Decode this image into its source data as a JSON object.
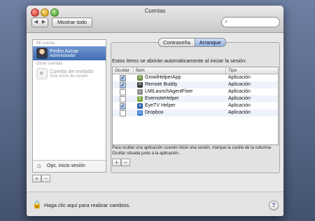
{
  "window": {
    "title": "Cuentas"
  },
  "toolbar": {
    "back_icon": "◀",
    "forward_icon": "▶",
    "show_all_label": "Mostrar todo",
    "search_icon": "⌕",
    "search_placeholder": ""
  },
  "sidebar": {
    "my_account_header": "Mi cuenta",
    "current_user": {
      "name": "Pedro Aznar",
      "role": "Administrador"
    },
    "other_accounts_header": "Otras cuentas",
    "guest": {
      "name": "Cuenta de invitado",
      "role": "Solo inicio de sesión"
    },
    "login_options_label": "Opc. inicio sesión",
    "add_label": "+",
    "remove_label": "−"
  },
  "tabs": [
    {
      "label": "Contraseña",
      "active": false
    },
    {
      "label": "Arranque",
      "active": true
    }
  ],
  "panel": {
    "description": "Estos ítems se abrirán automáticamente al iniciar la sesión:",
    "columns": {
      "hide": "Ocultar",
      "item": "Ítem",
      "type": "Tipo"
    },
    "rows": [
      {
        "checked": true,
        "check_mark": "✓",
        "name": "GrowlHelperApp",
        "type": "Aplicación",
        "icon_color": "#6b8e3a",
        "icon_glyph": "G"
      },
      {
        "checked": true,
        "check_mark": "✓",
        "name": "Remote Buddy",
        "type": "Aplicación",
        "icon_color": "#333333",
        "icon_glyph": "R"
      },
      {
        "checked": false,
        "check_mark": "",
        "name": "LMILaunchAgentFixer",
        "type": "Aplicación",
        "icon_color": "#8a8a8a",
        "icon_glyph": "L"
      },
      {
        "checked": false,
        "check_mark": "",
        "name": "EvernoteHelper",
        "type": "Aplicación",
        "icon_color": "#7aa83a",
        "icon_glyph": "E"
      },
      {
        "checked": true,
        "check_mark": "✓",
        "name": "EyeTV Helper",
        "type": "Aplicación",
        "icon_color": "#2a5fa8",
        "icon_glyph": "e"
      },
      {
        "checked": false,
        "check_mark": "",
        "name": "Dropbox",
        "type": "Aplicación",
        "icon_color": "#3b7dd8",
        "icon_glyph": "D"
      }
    ],
    "hint": "Para ocultar una aplicación cuando inicie una sesión, marque la casilla de la columna Ocultar situada junto a la aplicación.",
    "add_label": "+",
    "remove_label": "−"
  },
  "footer": {
    "lock_icon": "🔒",
    "lock_text": "Haga clic aquí para realizar cambios.",
    "help_label": "?"
  }
}
